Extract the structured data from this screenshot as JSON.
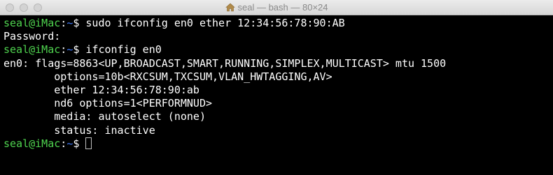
{
  "window": {
    "title": "seal — bash — 80×24"
  },
  "prompt": {
    "user_host": "seal@iMac",
    "separator": ":",
    "path": "~",
    "symbol": "$ "
  },
  "lines": [
    {
      "type": "prompt",
      "command": "sudo ifconfig en0 ether 12:34:56:78:90:AB"
    },
    {
      "type": "output",
      "text": "Password:"
    },
    {
      "type": "prompt",
      "command": "ifconfig en0"
    },
    {
      "type": "output",
      "text": "en0: flags=8863<UP,BROADCAST,SMART,RUNNING,SIMPLEX,MULTICAST> mtu 1500"
    },
    {
      "type": "output",
      "text": "\toptions=10b<RXCSUM,TXCSUM,VLAN_HWTAGGING,AV>"
    },
    {
      "type": "output",
      "text": "\tether 12:34:56:78:90:ab"
    },
    {
      "type": "output",
      "text": "\tnd6 options=1<PERFORMNUD>"
    },
    {
      "type": "output",
      "text": "\tmedia: autoselect (none)"
    },
    {
      "type": "output",
      "text": "\tstatus: inactive"
    },
    {
      "type": "prompt",
      "command": ""
    }
  ],
  "colors": {
    "background": "#000000",
    "user_host": "#4fd44f",
    "path": "#3f7cff",
    "text": "#ffffff"
  },
  "icons": {
    "title_icon": "home-icon"
  }
}
